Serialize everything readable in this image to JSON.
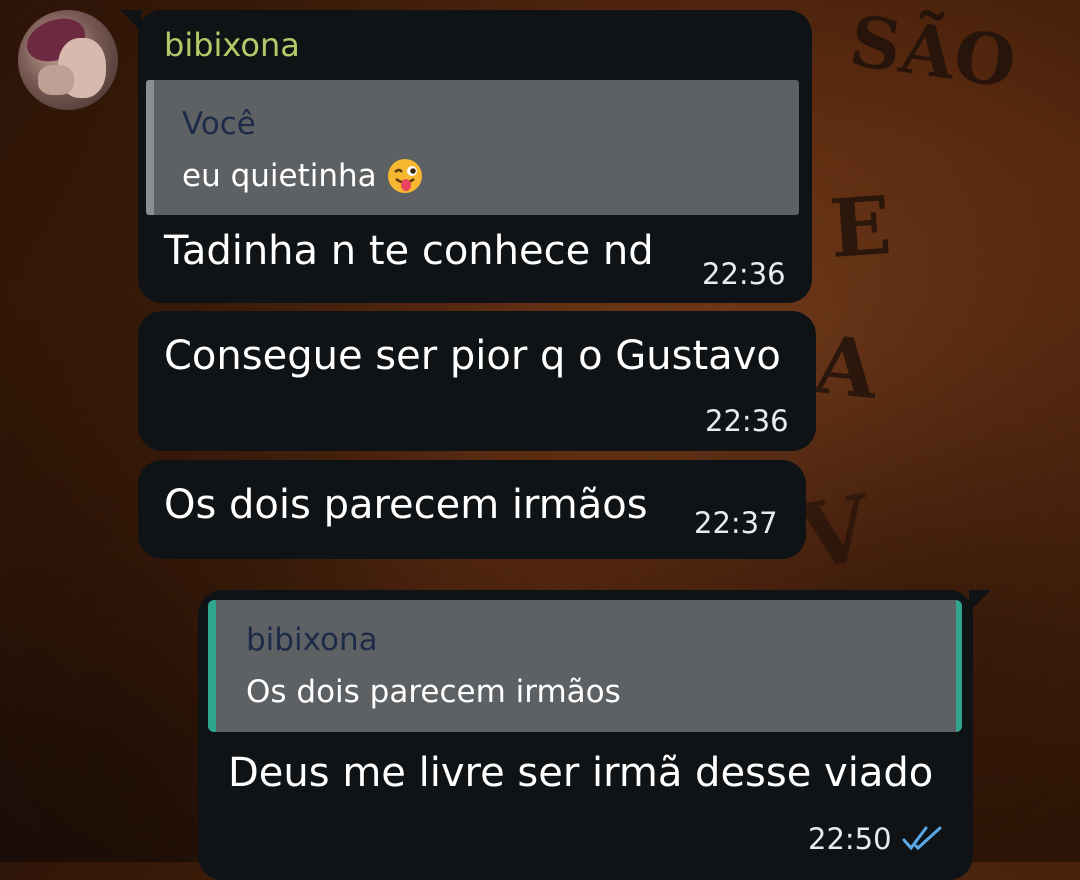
{
  "conversation": {
    "contact": {
      "name": "bibixona"
    },
    "messages": [
      {
        "direction": "incoming",
        "sender": "bibixona",
        "reply_to": {
          "author": "Você",
          "text": "eu quietinha",
          "emoji": "winking-face-with-tongue"
        },
        "text": "Tadinha n te conhece nd",
        "time": "22:36"
      },
      {
        "direction": "incoming",
        "text": "Consegue ser pior q o Gustavo",
        "time": "22:36"
      },
      {
        "direction": "incoming",
        "text": "Os dois parecem irmãos",
        "time": "22:37"
      },
      {
        "direction": "outgoing",
        "reply_to": {
          "author": "bibixona",
          "text": "Os dois parecem irmãos"
        },
        "text": "Deus me livre ser irmã desse viado",
        "time": "22:50",
        "status": "read"
      }
    ]
  },
  "colors": {
    "bubble": "#0f1316",
    "sender_name": "#b7c86a",
    "quote_bg": "#5e6164",
    "quote_author": "#1d2a48",
    "outgoing_quote_accent": "#2fa58f",
    "read_ticks": "#5aa8e6"
  }
}
